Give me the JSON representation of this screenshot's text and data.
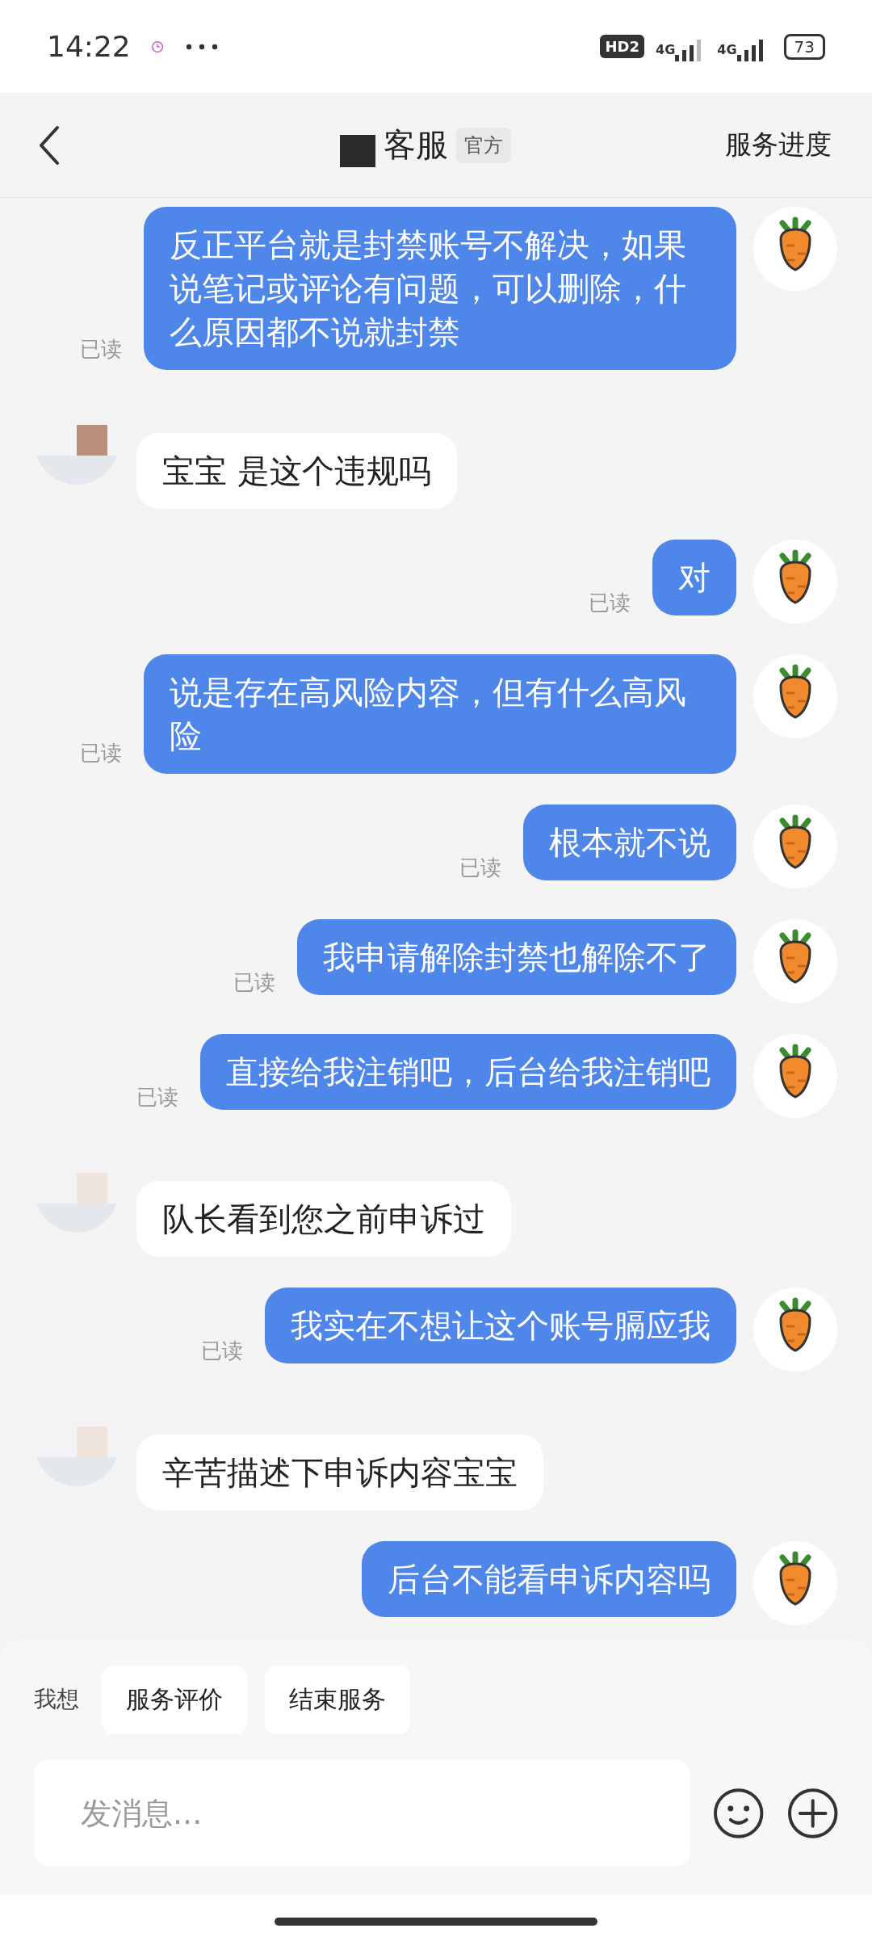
{
  "status_bar": {
    "time": "14:22",
    "hd_badge": "HD2",
    "networks": [
      "4G",
      "4G"
    ],
    "battery": "73"
  },
  "header": {
    "title": "客服",
    "badge": "官方",
    "action": "服务进度"
  },
  "messages": [
    {
      "kind": "sent",
      "text": "反正平台就是封禁账号不解决，如果说笔记或评论有问题，可以删除，什么原因都不说就封禁",
      "read": "已读"
    },
    {
      "kind": "received",
      "text": "宝宝 是这个违规吗"
    },
    {
      "kind": "sent",
      "text": "对",
      "read": "已读"
    },
    {
      "kind": "sent",
      "text": "说是存在高风险内容，但有什么高风险",
      "read": "已读"
    },
    {
      "kind": "sent",
      "text": "根本就不说",
      "read": "已读"
    },
    {
      "kind": "sent",
      "text": "我申请解除封禁也解除不了",
      "read": "已读"
    },
    {
      "kind": "sent",
      "text": "直接给我注销吧，后台给我注销吧",
      "read": "已读"
    },
    {
      "kind": "received",
      "text": "队长看到您之前申诉过"
    },
    {
      "kind": "sent",
      "text": "我实在不想让这个账号膈应我",
      "read": "已读"
    },
    {
      "kind": "received",
      "text": "辛苦描述下申诉内容宝宝"
    },
    {
      "kind": "sent",
      "text": "后台不能看申诉内容吗"
    }
  ],
  "quick_actions": {
    "label": "我想",
    "chips": [
      "服务评价",
      "结束服务"
    ]
  },
  "composer": {
    "placeholder": "发消息..."
  }
}
